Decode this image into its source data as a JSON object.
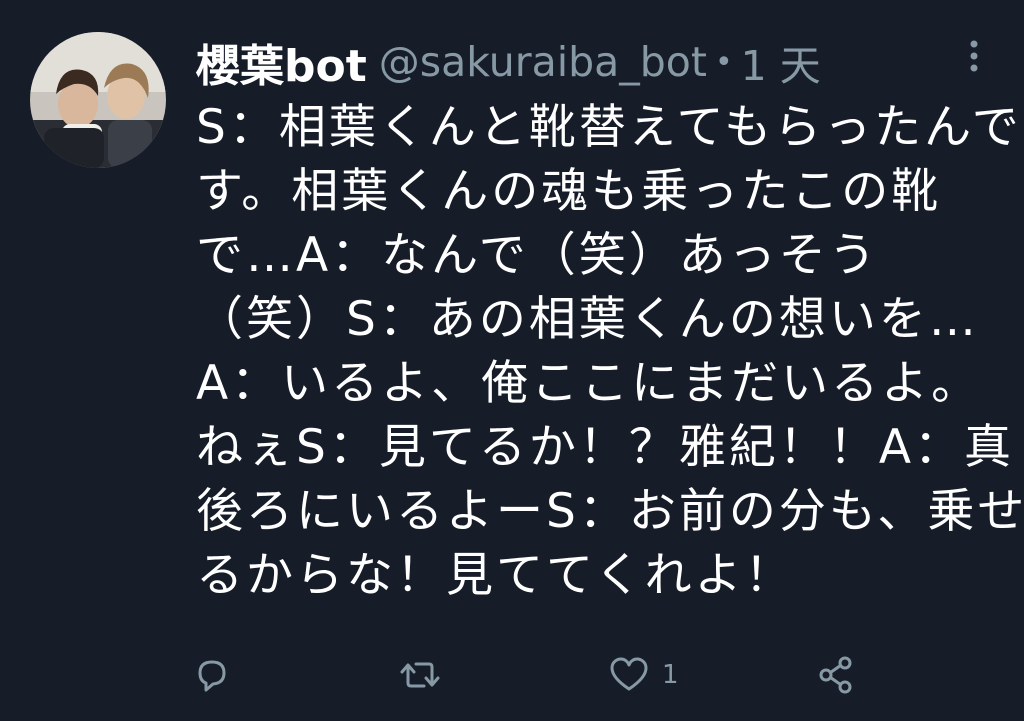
{
  "tweet": {
    "display_name": "櫻葉bot",
    "handle": "@sakuraiba_bot",
    "separator": "•",
    "time": "1 天",
    "text_lines": [
      "S：相葉くんと靴替えてもらったんで",
      "す。相葉くんの魂も乗ったこの靴",
      "で…A：なんで（笑）あっそう",
      "（笑）S：あの相葉くんの想いを…",
      "A：いるよ、俺ここにまだいるよ。",
      "ねぇS：見てるか！？雅紀！！A：真",
      "後ろにいるよーS：お前の分も、乗せ",
      "るからな！見ててくれよ！"
    ]
  },
  "actions": {
    "reply_icon": "reply-icon",
    "retweet_icon": "retweet-icon",
    "like_icon": "heart-icon",
    "like_count": "1",
    "share_icon": "share-icon"
  },
  "colors": {
    "background": "#161d29",
    "text": "#ffffff",
    "muted": "#8899a6"
  }
}
